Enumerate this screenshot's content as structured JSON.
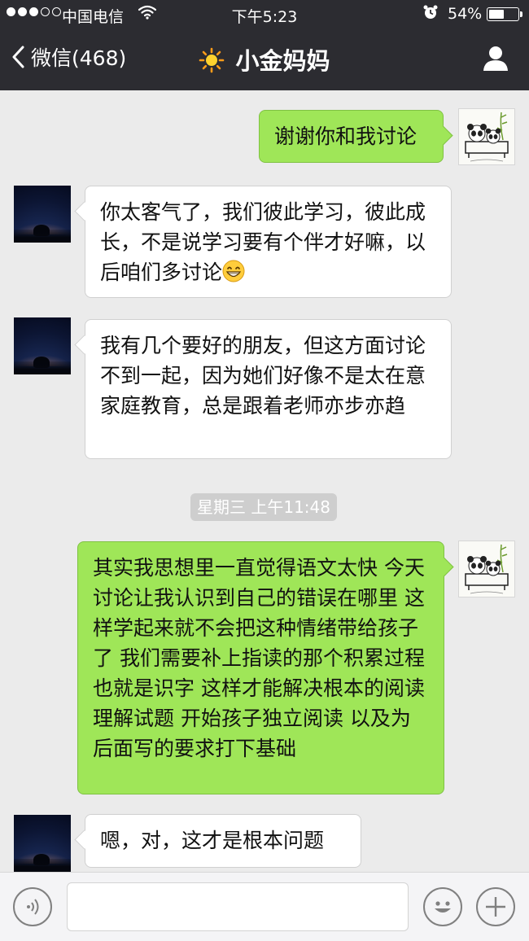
{
  "status_bar": {
    "carrier": "中国电信",
    "time": "下午5:23",
    "battery": "54%",
    "battery_level": 0.54
  },
  "nav": {
    "back_label": "微信(468)",
    "title": "小金妈妈",
    "title_icon": "sun-emoji",
    "profile_icon": "person-icon"
  },
  "messages": [
    {
      "side": "right",
      "avatar": "panda-avatar",
      "text": "谢谢你和我讨论"
    },
    {
      "side": "left",
      "avatar": "night-sky-avatar",
      "text": "你太客气了，我们彼此学习，彼此成长，不是说学习要有个伴才好嘛，以后咱们多讨论",
      "emoji": "grinning-face"
    },
    {
      "side": "left",
      "avatar": "night-sky-avatar",
      "text": "我有几个要好的朋友，但这方面讨论不到一起，因为她们好像不是太在意家庭教育，总是跟着老师亦步亦趋"
    },
    {
      "side": "right",
      "avatar": "panda-avatar",
      "text": "其实我思想里一直觉得语文太快 今天讨论让我认识到自己的错误在哪里 这样学起来就不会把这种情绪带给孩子了 我们需要补上指读的那个积累过程 也就是识字 这样才能解决根本的阅读理解试题 开始孩子独立阅读 以及为后面写的要求打下基础"
    },
    {
      "side": "left",
      "avatar": "night-sky-avatar",
      "text": "嗯，对，这才是根本问题"
    }
  ],
  "timestamp": "星期三 上午11:48",
  "input_bar": {
    "voice_icon": "voice-icon",
    "emoji_icon": "emoji-icon",
    "plus_icon": "plus-icon",
    "placeholder": ""
  },
  "colors": {
    "nav_bg": "#2c2c31",
    "chat_bg": "#ebebeb",
    "sent_bubble": "#9fe658",
    "received_bubble": "#ffffff"
  }
}
